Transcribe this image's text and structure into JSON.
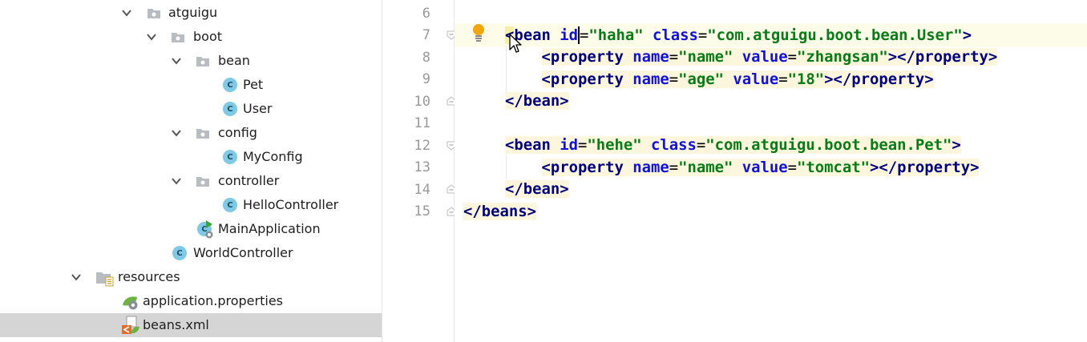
{
  "project_tree": {
    "items": [
      {
        "label": "atguigu",
        "icon": "package-folder-icon"
      },
      {
        "label": "boot",
        "icon": "package-folder-icon"
      },
      {
        "label": "bean",
        "icon": "package-folder-icon"
      },
      {
        "label": "Pet",
        "icon": "class-icon",
        "icon_text": "C"
      },
      {
        "label": "User",
        "icon": "class-icon",
        "icon_text": "C"
      },
      {
        "label": "config",
        "icon": "package-folder-icon"
      },
      {
        "label": "MyConfig",
        "icon": "class-icon",
        "icon_text": "C"
      },
      {
        "label": "controller",
        "icon": "package-folder-icon"
      },
      {
        "label": "HelloController",
        "icon": "class-icon",
        "icon_text": "C"
      },
      {
        "label": "MainApplication",
        "icon": "spring-boot-app-icon",
        "icon_text": "C"
      },
      {
        "label": "WorldController",
        "icon": "class-icon",
        "icon_text": "C"
      },
      {
        "label": "resources",
        "icon": "resources-folder-icon"
      },
      {
        "label": "application.properties",
        "icon": "spring-properties-icon"
      },
      {
        "label": "beans.xml",
        "icon": "xml-file-icon",
        "selected": true
      }
    ]
  },
  "editor": {
    "line_numbers": [
      "6",
      "7",
      "8",
      "9",
      "10",
      "11",
      "12",
      "13",
      "14",
      "15"
    ],
    "code": {
      "l7": {
        "lt": "<",
        "tag": "bean",
        "sp1": " ",
        "a1": "id",
        "eq1": "=",
        "v1": "\"haha\"",
        "sp2": " ",
        "a2": "class",
        "eq2": "=",
        "v2": "\"com.atguigu.boot.bean.User\"",
        "gt": ">"
      },
      "l8": {
        "ind": "    ",
        "lt": "<",
        "tag": "property",
        "sp1": " ",
        "a1": "name",
        "eq1": "=",
        "v1": "\"name\"",
        "sp2": " ",
        "a2": "value",
        "eq2": "=",
        "v2": "\"zhangsan\"",
        "gt": ">",
        "close": "</property>"
      },
      "l9": {
        "ind": "    ",
        "lt": "<",
        "tag": "property",
        "sp1": " ",
        "a1": "name",
        "eq1": "=",
        "v1": "\"age\"",
        "sp2": " ",
        "a2": "value",
        "eq2": "=",
        "v2": "\"18\"",
        "gt": ">",
        "close": "</property>"
      },
      "l10": {
        "close": "</bean>"
      },
      "l12": {
        "lt": "<",
        "tag": "bean",
        "sp1": " ",
        "a1": "id",
        "eq1": "=",
        "v1": "\"hehe\"",
        "sp2": " ",
        "a2": "class",
        "eq2": "=",
        "v2": "\"com.atguigu.boot.bean.Pet\"",
        "gt": ">"
      },
      "l13": {
        "ind": "    ",
        "lt": "<",
        "tag": "property",
        "sp1": " ",
        "a1": "name",
        "eq1": "=",
        "v1": "\"name\"",
        "sp2": " ",
        "a2": "value",
        "eq2": "=",
        "v2": "\"tomcat\"",
        "gt": ">",
        "close": "</property>"
      },
      "l14": {
        "close": "</bean>"
      },
      "l15": {
        "close": "</beans>"
      }
    },
    "intention_icon": "lightbulb-icon",
    "colors": {
      "tag": "#000080",
      "attr": "#1010e0",
      "value": "#067d17",
      "highlight": "#fcf7dc"
    }
  }
}
